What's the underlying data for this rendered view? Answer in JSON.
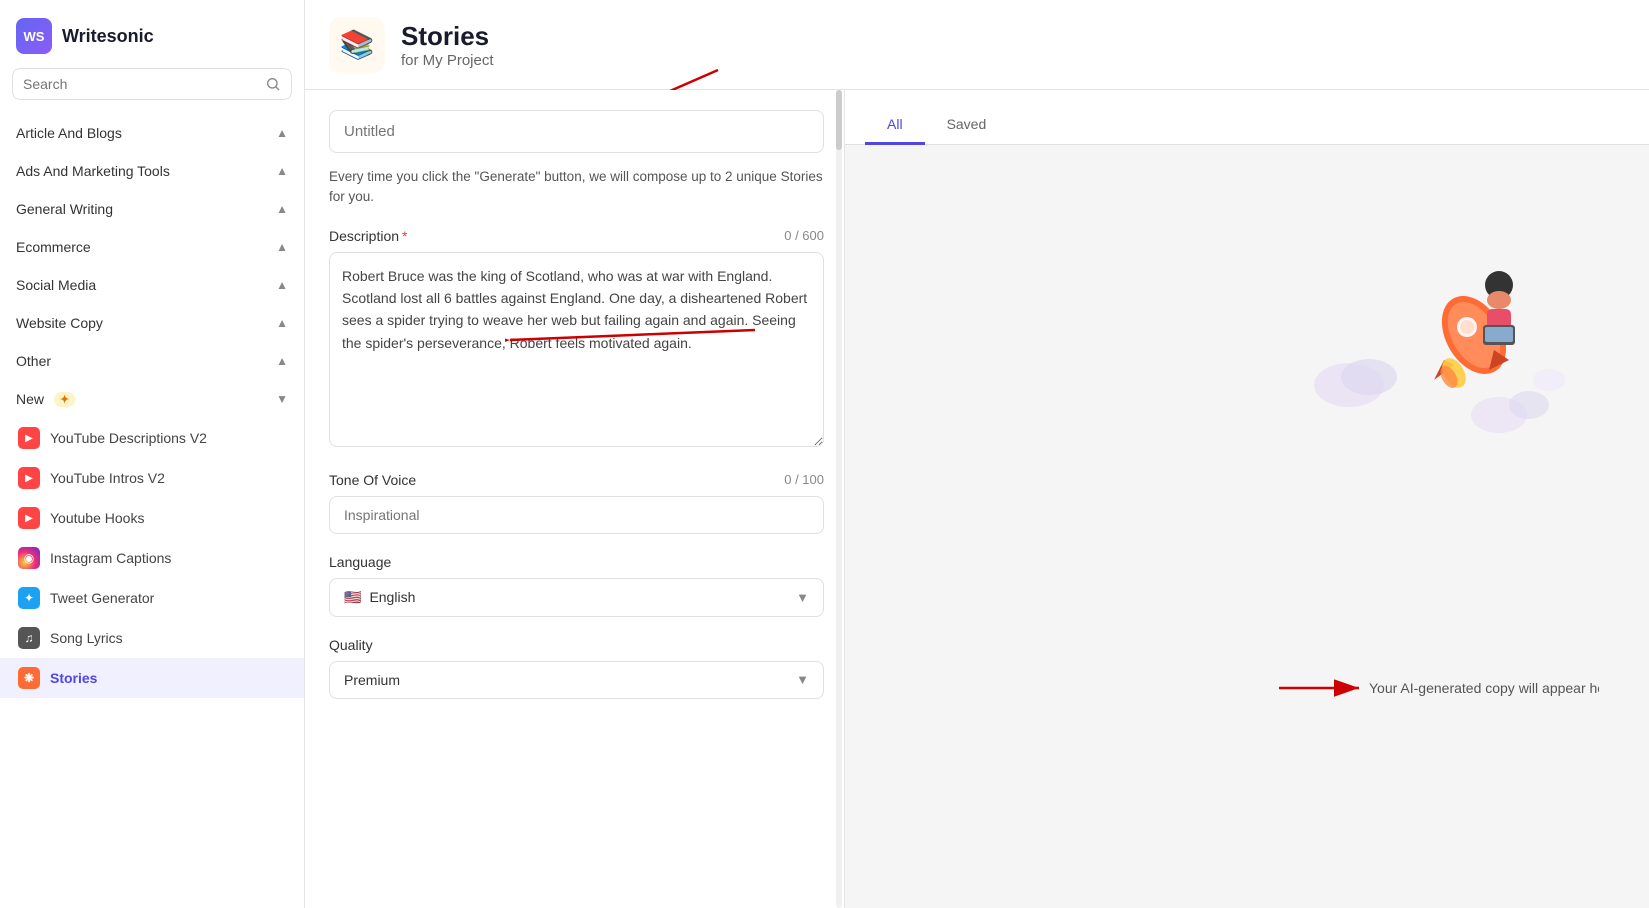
{
  "app": {
    "name": "Writesonic",
    "logo_text": "WS"
  },
  "sidebar": {
    "search_placeholder": "Search",
    "categories": [
      {
        "id": "article-blogs",
        "label": "Article And Blogs",
        "expanded": false
      },
      {
        "id": "ads-marketing",
        "label": "Ads And Marketing Tools",
        "expanded": false
      },
      {
        "id": "general-writing",
        "label": "General Writing",
        "expanded": false
      },
      {
        "id": "ecommerce",
        "label": "Ecommerce",
        "expanded": false
      },
      {
        "id": "social-media",
        "label": "Social Media",
        "expanded": false
      },
      {
        "id": "website-copy",
        "label": "Website Copy",
        "expanded": false
      },
      {
        "id": "other",
        "label": "Other",
        "expanded": false
      },
      {
        "id": "new",
        "label": "New",
        "expanded": true,
        "badge": "✦"
      }
    ],
    "new_items": [
      {
        "id": "youtube-desc",
        "label": "YouTube Descriptions V2",
        "icon": "▶",
        "icon_type": "red"
      },
      {
        "id": "youtube-intros",
        "label": "YouTube Intros V2",
        "icon": "▶",
        "icon_type": "red"
      },
      {
        "id": "youtube-hooks",
        "label": "Youtube Hooks",
        "icon": "▶",
        "icon_type": "red"
      },
      {
        "id": "instagram-captions",
        "label": "Instagram Captions",
        "icon": "◉",
        "icon_type": "pink"
      },
      {
        "id": "tweet-generator",
        "label": "Tweet Generator",
        "icon": "✦",
        "icon_type": "blue"
      },
      {
        "id": "song-lyrics",
        "label": "Song Lyrics",
        "icon": "♫",
        "icon_type": "gray"
      },
      {
        "id": "stories",
        "label": "Stories",
        "icon": "❋",
        "icon_type": "stories",
        "active": true
      }
    ]
  },
  "header": {
    "title": "Stories",
    "subtitle": "for My Project",
    "icon": "📚"
  },
  "form": {
    "title_placeholder": "Untitled",
    "helper_text": "Every time you click the \"Generate\" button, we will compose up to 2 unique Stories for you.",
    "description_label": "Description",
    "description_required": true,
    "description_counter": "0 / 600",
    "description_value": "Robert Bruce was the king of Scotland, who was at war with England. Scotland lost all 6 battles against England. One day, a disheartened Robert sees a spider trying to weave her web but failing again and again. Seeing the spider's perseverance, Robert feels motivated again.",
    "tone_label": "Tone Of Voice",
    "tone_counter": "0 / 100",
    "tone_placeholder": "Inspirational",
    "language_label": "Language",
    "language_value": "English",
    "language_flag": "🇺🇸",
    "quality_label": "Quality",
    "quality_value": "Premium"
  },
  "tabs": {
    "all_label": "All",
    "saved_label": "Saved",
    "active": "all"
  },
  "results": {
    "placeholder_text": "Your AI-generated copy will appear here."
  }
}
